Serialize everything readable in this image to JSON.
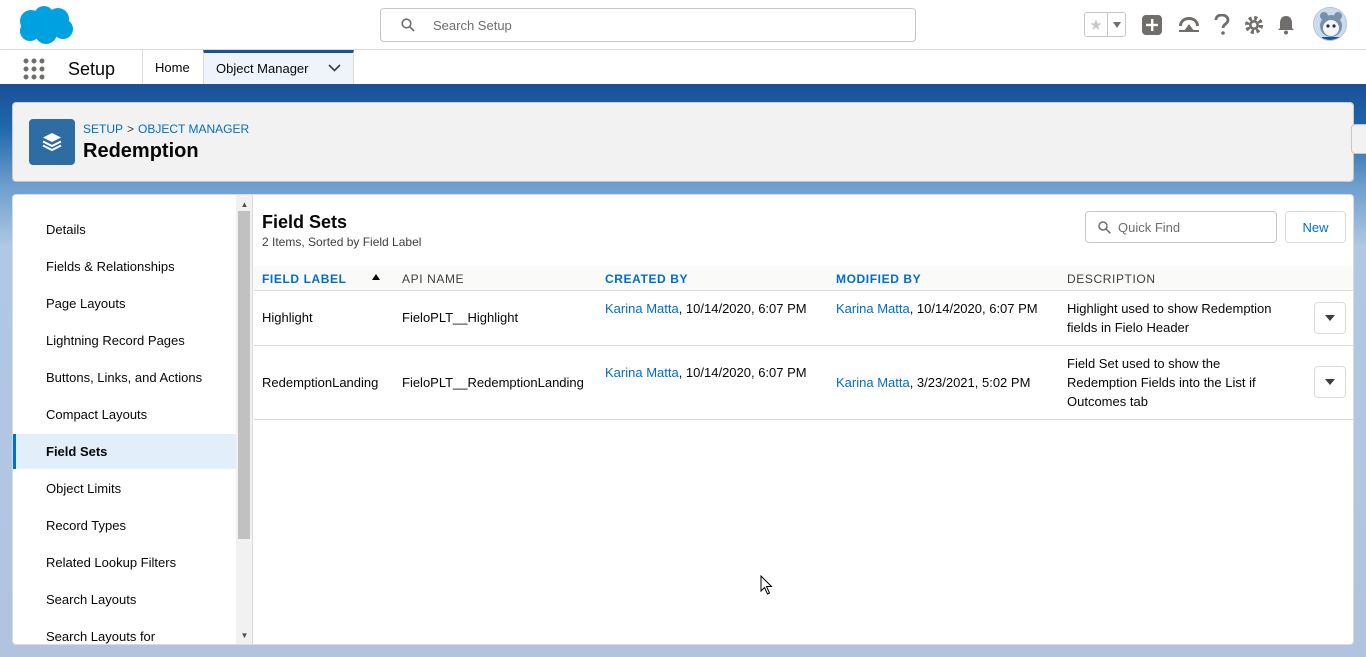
{
  "header": {
    "search_placeholder": "Search Setup",
    "star_glyph": "★"
  },
  "context": {
    "app_name": "Setup",
    "tabs": [
      {
        "label": "Home"
      },
      {
        "label": "Object Manager"
      }
    ]
  },
  "page": {
    "breadcrumb": [
      "SETUP",
      "OBJECT MANAGER"
    ],
    "breadcrumb_sep": ">",
    "title": "Redemption"
  },
  "sidebar": {
    "items": [
      {
        "label": "Details"
      },
      {
        "label": "Fields & Relationships"
      },
      {
        "label": "Page Layouts"
      },
      {
        "label": "Lightning Record Pages"
      },
      {
        "label": "Buttons, Links, and Actions"
      },
      {
        "label": "Compact Layouts"
      },
      {
        "label": "Field Sets"
      },
      {
        "label": "Object Limits"
      },
      {
        "label": "Record Types"
      },
      {
        "label": "Related Lookup Filters"
      },
      {
        "label": "Search Layouts"
      },
      {
        "label": "Search Layouts for"
      }
    ],
    "active_index": 6
  },
  "content": {
    "title": "Field Sets",
    "subtitle": "2 Items, Sorted by Field Label",
    "quick_find_placeholder": "Quick Find",
    "new_label": "New",
    "columns": [
      "FIELD LABEL",
      "API NAME",
      "CREATED BY",
      "MODIFIED BY",
      "DESCRIPTION"
    ],
    "rows": [
      {
        "field_label": "Highlight",
        "api_name": "FieloPLT__Highlight",
        "created_by_user": "Karina Matta",
        "created_by_date": ", 10/14/2020, 6:07 PM",
        "modified_by_user": "Karina Matta",
        "modified_by_date": ", 10/14/2020, 6:07 PM",
        "description": "Highlight used to show Redemption fields in Fielo Header"
      },
      {
        "field_label": "RedemptionLanding",
        "api_name": "FieloPLT__RedemptionLanding",
        "created_by_user": "Karina Matta",
        "created_by_date": ", 10/14/2020, 6:07 PM",
        "modified_by_user": "Karina Matta",
        "modified_by_date": ", 3/23/2021, 5:02 PM",
        "description": "Field Set used to show the Redemption Fields into the List if Outcomes tab"
      }
    ]
  },
  "colors": {
    "brand_blue": "#1b5297",
    "link_blue": "#006dcc",
    "object_icon": "#2e6da4"
  },
  "icons": [
    "salesforce-cloud-logo",
    "search-icon",
    "star-icon",
    "add-icon",
    "trailhead-icon",
    "help-icon",
    "gear-icon",
    "bell-icon",
    "app-launcher-icon",
    "chevron-down-icon",
    "layers-icon"
  ]
}
